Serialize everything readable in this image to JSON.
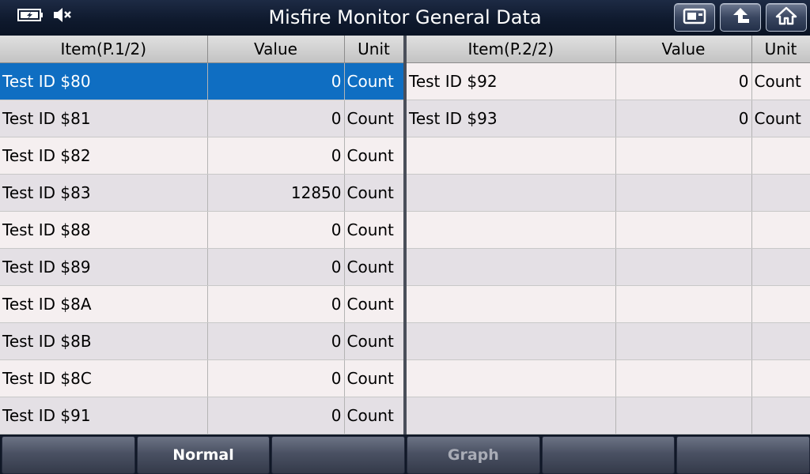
{
  "header": {
    "title": "Misfire Monitor General Data"
  },
  "left_table": {
    "columns": [
      "Item(P.1/2)",
      "Value",
      "Unit"
    ],
    "rows": [
      {
        "item": "Test ID $80",
        "value": "0",
        "unit": "Count",
        "selected": true
      },
      {
        "item": "Test ID $81",
        "value": "0",
        "unit": "Count"
      },
      {
        "item": "Test ID $82",
        "value": "0",
        "unit": "Count"
      },
      {
        "item": "Test ID $83",
        "value": "12850",
        "unit": "Count"
      },
      {
        "item": "Test ID $88",
        "value": "0",
        "unit": "Count"
      },
      {
        "item": "Test ID $89",
        "value": "0",
        "unit": "Count"
      },
      {
        "item": "Test ID $8A",
        "value": "0",
        "unit": "Count"
      },
      {
        "item": "Test ID $8B",
        "value": "0",
        "unit": "Count"
      },
      {
        "item": "Test ID $8C",
        "value": "0",
        "unit": "Count"
      },
      {
        "item": "Test ID $91",
        "value": "0",
        "unit": "Count"
      }
    ]
  },
  "right_table": {
    "columns": [
      "Item(P.2/2)",
      "Value",
      "Unit"
    ],
    "rows": [
      {
        "item": "Test ID $92",
        "value": "0",
        "unit": "Count"
      },
      {
        "item": "Test ID $93",
        "value": "0",
        "unit": "Count"
      },
      {
        "item": "",
        "value": "",
        "unit": ""
      },
      {
        "item": "",
        "value": "",
        "unit": ""
      },
      {
        "item": "",
        "value": "",
        "unit": ""
      },
      {
        "item": "",
        "value": "",
        "unit": ""
      },
      {
        "item": "",
        "value": "",
        "unit": ""
      },
      {
        "item": "",
        "value": "",
        "unit": ""
      },
      {
        "item": "",
        "value": "",
        "unit": ""
      },
      {
        "item": "",
        "value": "",
        "unit": ""
      }
    ]
  },
  "bottom_bar": {
    "buttons": [
      "",
      "Normal",
      "",
      "Graph",
      "",
      ""
    ]
  },
  "colors": {
    "selected_row": "#0f6ec2",
    "title_bar": "#0f1a2e"
  }
}
